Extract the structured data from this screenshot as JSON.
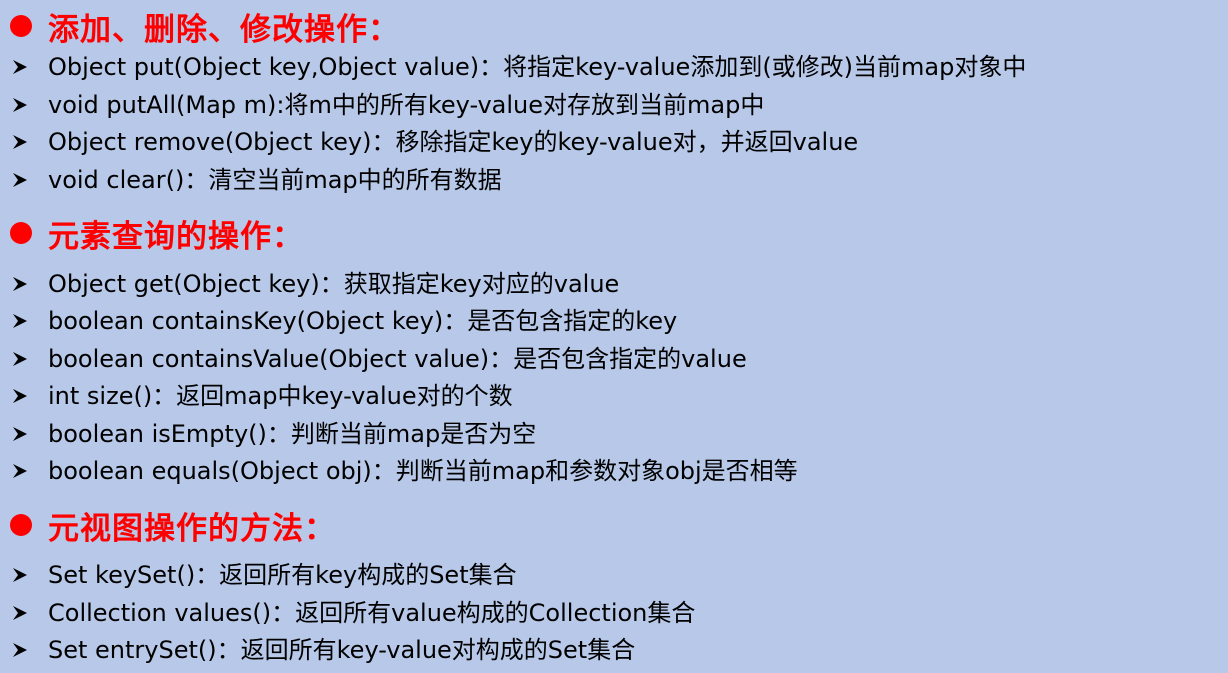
{
  "colors": {
    "background": "#b7c8e8",
    "heading": "#ff0000",
    "text": "#000000"
  },
  "sections": [
    {
      "heading": "添加、删除、修改操作：",
      "items": [
        "Object put(Object key,Object value)：将指定key-value添加到(或修改)当前map对象中",
        "void putAll(Map m):将m中的所有key-value对存放到当前map中",
        "Object remove(Object key)：移除指定key的key-value对，并返回value",
        "void clear()：清空当前map中的所有数据"
      ]
    },
    {
      "heading": "元素查询的操作：",
      "items": [
        "Object get(Object key)：获取指定key对应的value",
        "boolean containsKey(Object key)：是否包含指定的key",
        "boolean containsValue(Object value)：是否包含指定的value",
        "int size()：返回map中key-value对的个数",
        "boolean isEmpty()：判断当前map是否为空",
        "boolean equals(Object obj)：判断当前map和参数对象obj是否相等"
      ]
    },
    {
      "heading": "元视图操作的方法：",
      "items": [
        "Set keySet()：返回所有key构成的Set集合",
        "Collection values()：返回所有value构成的Collection集合",
        "Set entrySet()：返回所有key-value对构成的Set集合"
      ]
    }
  ]
}
